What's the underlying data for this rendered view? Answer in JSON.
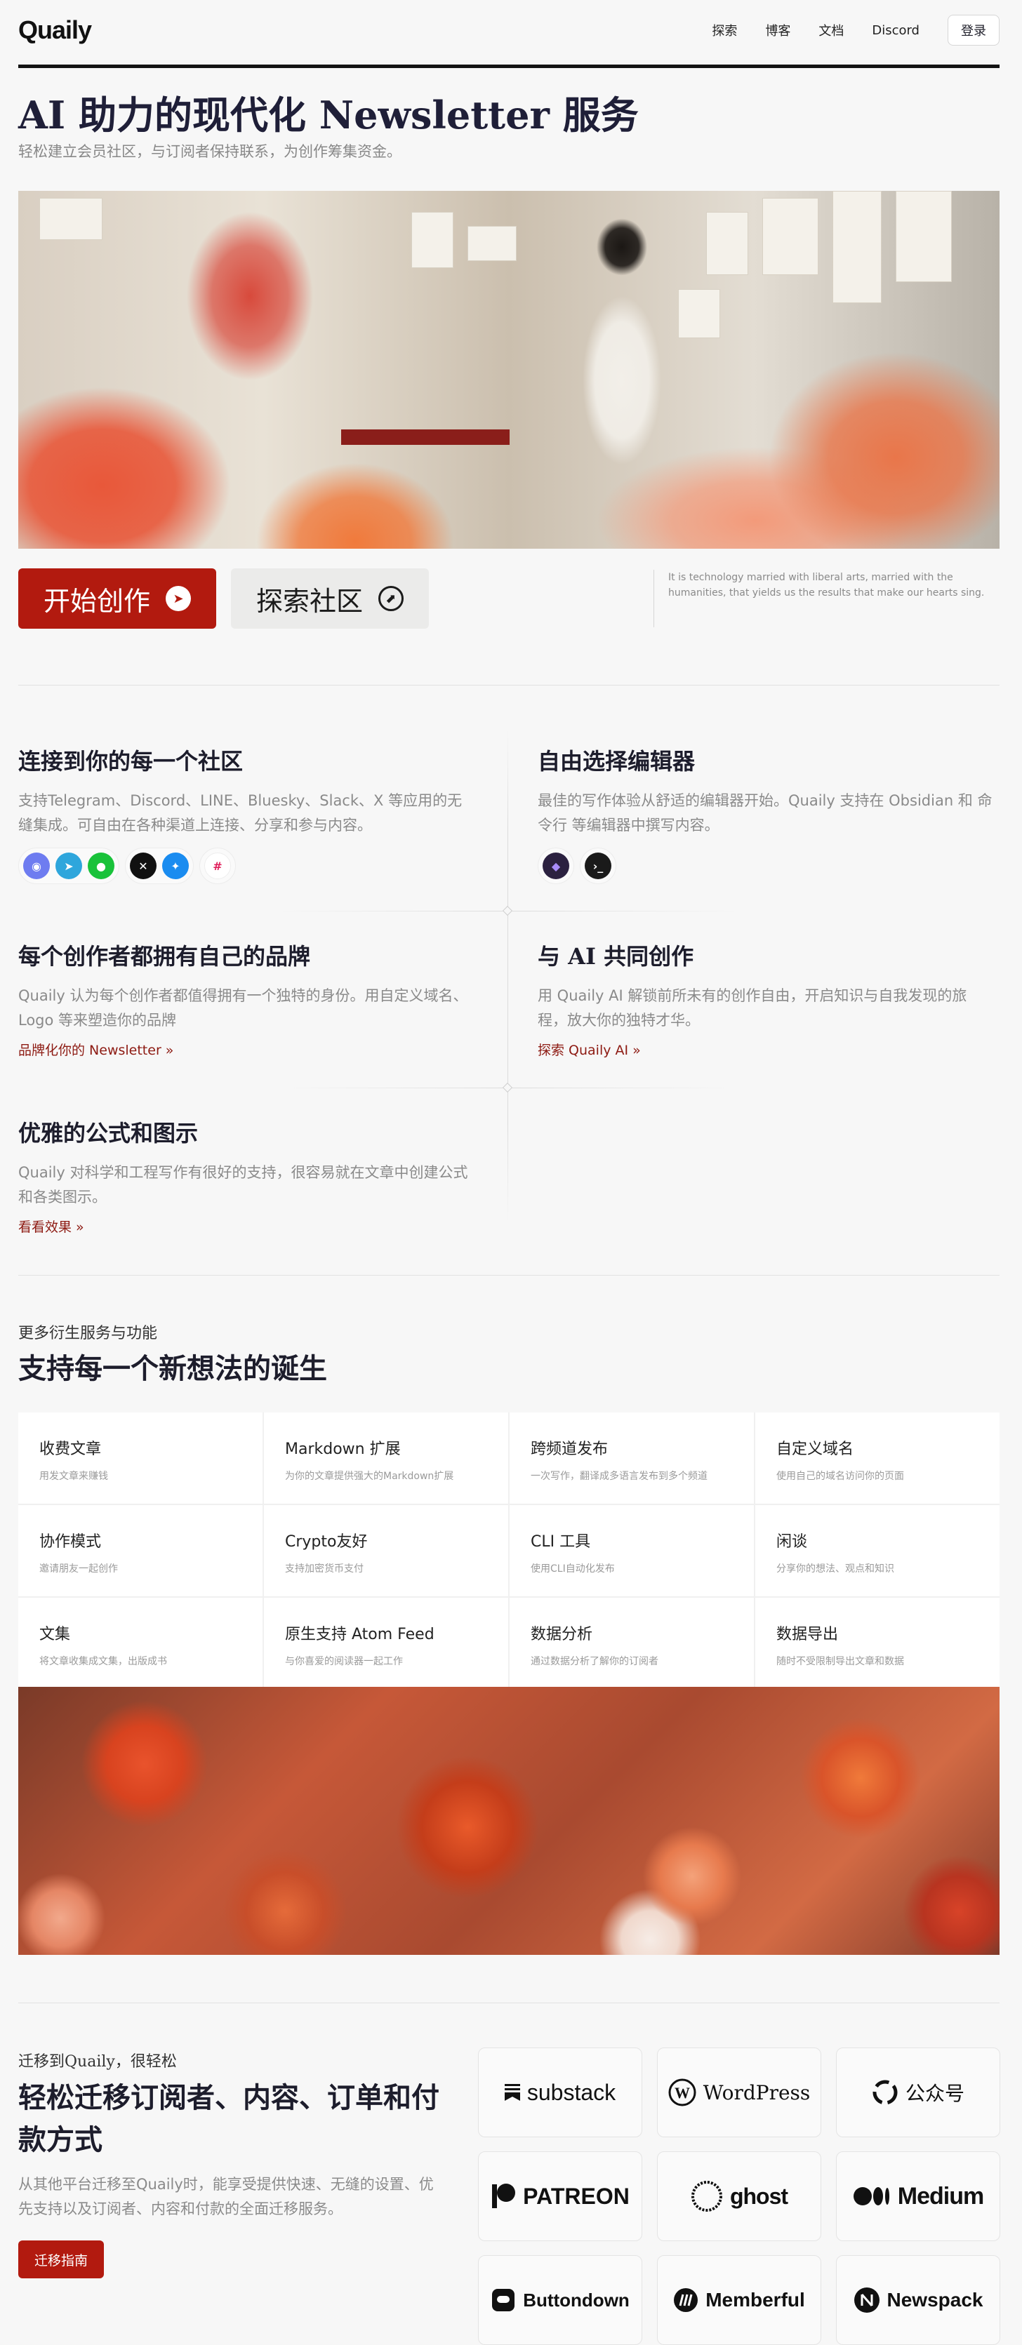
{
  "nav": {
    "logo": "Quaily",
    "links": [
      "探索",
      "博客",
      "文档",
      "Discord"
    ],
    "login": "登录"
  },
  "hero": {
    "title": "AI 助力的现代化 Newsletter 服务",
    "subtitle": "轻松建立会员社区，与订阅者保持联系，为创作筹集资金。",
    "primary_button": "开始创作",
    "secondary_button": "探索社区",
    "quote": "It is technology married with liberal arts, married with the humanities, that yields us the results that make our hearts sing."
  },
  "features": [
    {
      "title": "连接到你的每一个社区",
      "desc": "支持Telegram、Discord、LINE、Bluesky、Slack、X 等应用的无缝集成。可自由在各种渠道上连接、分享和参与内容。",
      "icons": [
        "discord-icon",
        "telegram-icon",
        "line-icon",
        "x-icon",
        "bluesky-icon",
        "slack-icon"
      ]
    },
    {
      "title": "自由选择编辑器",
      "desc": "最佳的写作体验从舒适的编辑器开始。Quaily 支持在 Obsidian 和 命令行 等编辑器中撰写内容。",
      "icons": [
        "obsidian-icon",
        "terminal-icon"
      ]
    },
    {
      "title": "每个创作者都拥有自己的品牌",
      "desc": "Quaily 认为每个创作者都值得拥有一个独特的身份。用自定义域名、Logo 等来塑造你的品牌",
      "link": "品牌化你的 Newsletter »"
    },
    {
      "title": "与 AI 共同创作",
      "desc": "用 Quaily AI 解锁前所未有的创作自由，开启知识与自我发现的旅程，放大你的独特才华。",
      "link": "探索 Quaily AI »"
    },
    {
      "title": "优雅的公式和图示",
      "desc": "Quaily 对科学和工程写作有很好的支持，很容易就在文章中创建公式和各类图示。",
      "link": "看看效果 »"
    }
  ],
  "more": {
    "kicker": "更多衍生服务与功能",
    "title": "支持每一个新想法的诞生",
    "items": [
      {
        "title": "收费文章",
        "desc": "用发文章来赚钱"
      },
      {
        "title": "Markdown 扩展",
        "desc": "为你的文章提供强大的Markdown扩展"
      },
      {
        "title": "跨频道发布",
        "desc": "一次写作，翻译成多语言发布到多个频道"
      },
      {
        "title": "自定义域名",
        "desc": "使用自己的域名访问你的页面"
      },
      {
        "title": "协作模式",
        "desc": "邀请朋友一起创作"
      },
      {
        "title": "Crypto友好",
        "desc": "支持加密货币支付"
      },
      {
        "title": "CLI 工具",
        "desc": "使用CLI自动化发布"
      },
      {
        "title": "闲谈",
        "desc": "分享你的想法、观点和知识"
      },
      {
        "title": "文集",
        "desc": "将文章收集成文集，出版成书"
      },
      {
        "title": "原生支持 Atom Feed",
        "desc": "与你喜爱的阅读器一起工作"
      },
      {
        "title": "数据分析",
        "desc": "通过数据分析了解你的订阅者"
      },
      {
        "title": "数据导出",
        "desc": "随时不受限制导出文章和数据"
      }
    ]
  },
  "migration": {
    "kicker": "迁移到Quaily，很轻松",
    "title": "轻松迁移订阅者、内容、订单和付款方式",
    "desc": "从其他平台迁移至Quaily时，能享受提供快速、无缝的设置、优先支持以及订阅者、内容和付款的全面迁移服务。",
    "button": "迁移指南",
    "platforms": [
      "substack",
      "WordPress",
      "公众号",
      "PATREON",
      "ghost",
      "Medium",
      "Buttondown",
      "Memberful",
      "Newspack"
    ]
  },
  "colors": {
    "brand_red": "#b21a0f",
    "link_red": "#8d1a12",
    "text_dark": "#1d1d2c",
    "text_muted": "#8a8a8a"
  }
}
